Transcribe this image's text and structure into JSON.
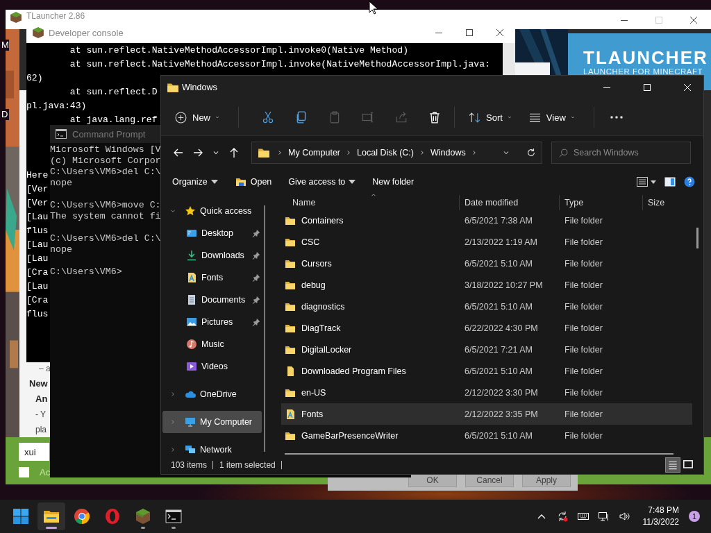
{
  "desktop_labels": [
    "M",
    "D"
  ],
  "tlauncher": {
    "title": "TLauncher 2.86",
    "active": false,
    "banner": {
      "title": "TLAUNCHER",
      "subtitle": "LAUNCHER FOR MINECRAFT"
    },
    "news": [
      {
        "text": "– a",
        "kind": "meta"
      },
      {
        "text": "New",
        "kind": "heading"
      },
      {
        "text": "An",
        "kind": "subheading"
      },
      {
        "text": "- Y",
        "kind": "body"
      },
      {
        "text": "pla",
        "kind": "body"
      }
    ],
    "login_field": {
      "value": "xui"
    },
    "checkbox": {
      "label": "Ac",
      "checked": false
    }
  },
  "dialog": {
    "buttons": [
      "OK",
      "Cancel",
      "Apply"
    ]
  },
  "dev_console": {
    "title": "Developer console",
    "active": false,
    "lines_top": [
      "        at sun.reflect.NativeMethodAccessorImpl.invoke0(Native Method)",
      "        at sun.reflect.NativeMethodAccessorImpl.invoke(NativeMethodAccessorImpl.java:",
      "62)",
      "        at sun.reflect.D",
      "pl.java:43)",
      "        at java.lang.ref"
    ],
    "lines_bottom": [
      "Here",
      "[Ver",
      "[Ver",
      "[Lau",
      "flus",
      "[Lau",
      "[Lau",
      "[Cra",
      "[Lau",
      "[Cra",
      "flus"
    ]
  },
  "command_prompt": {
    "title": "Command Prompt",
    "active": false,
    "blocks": [
      [
        "Microsoft Windows [V",
        "(c) Microsoft Corpor",
        "C:\\Users\\VM6>del C:\\",
        "nope"
      ],
      [
        "C:\\Users\\VM6>move C:",
        "The system cannot fi"
      ],
      [
        "C:\\Users\\VM6>del C:\\",
        "nope"
      ],
      [
        "C:\\Users\\VM6>"
      ]
    ]
  },
  "explorer": {
    "title": "Windows",
    "active": true,
    "command_bar": [
      {
        "kind": "new",
        "label": "New"
      },
      {
        "kind": "separator"
      },
      {
        "kind": "cut",
        "disabled": false
      },
      {
        "kind": "copy",
        "disabled": false
      },
      {
        "kind": "paste",
        "disabled": true
      },
      {
        "kind": "rename",
        "disabled": true
      },
      {
        "kind": "share",
        "disabled": true
      },
      {
        "kind": "delete",
        "disabled": false
      },
      {
        "kind": "separator"
      },
      {
        "kind": "sort",
        "label": "Sort"
      },
      {
        "kind": "view",
        "label": "View"
      },
      {
        "kind": "separator"
      },
      {
        "kind": "more"
      }
    ],
    "address": {
      "segments": [
        "My Computer",
        "Local Disk (C:)",
        "Windows"
      ]
    },
    "search": {
      "placeholder": "Search Windows"
    },
    "toolbar": [
      {
        "kind": "menu",
        "label": "Organize"
      },
      {
        "kind": "open",
        "label": "Open"
      },
      {
        "kind": "menu",
        "label": "Give access to"
      },
      {
        "kind": "plain",
        "label": "New folder"
      }
    ],
    "nav": [
      {
        "label": "Quick access",
        "kind": "star",
        "expanded": true,
        "selected": false,
        "children": [
          {
            "label": "Desktop",
            "kind": "desktop",
            "pinned": true,
            "selected": false
          },
          {
            "label": "Downloads",
            "kind": "downloads",
            "pinned": true,
            "selected": false
          },
          {
            "label": "Fonts",
            "kind": "fonts",
            "pinned": true,
            "selected": false
          },
          {
            "label": "Documents",
            "kind": "documents",
            "pinned": true,
            "selected": false
          },
          {
            "label": "Pictures",
            "kind": "pictures",
            "pinned": true,
            "selected": false
          },
          {
            "label": "Music",
            "kind": "music",
            "pinned": false,
            "selected": false
          },
          {
            "label": "Videos",
            "kind": "videos",
            "pinned": false,
            "selected": false
          }
        ]
      },
      {
        "label": "OneDrive",
        "kind": "cloud",
        "expanded": false,
        "selected": false
      },
      {
        "label": "My Computer",
        "kind": "computer",
        "expanded": false,
        "selected": true
      },
      {
        "label": "Network",
        "kind": "network",
        "expanded": false,
        "selected": false
      }
    ],
    "columns": [
      {
        "label": "Name",
        "sorted": true
      },
      {
        "label": "Date modified",
        "sorted": false
      },
      {
        "label": "Type",
        "sorted": false
      },
      {
        "label": "Size",
        "sorted": false
      }
    ],
    "rows": [
      {
        "name": "Containers",
        "date": "6/5/2021 7:38 AM",
        "type": "File folder",
        "kind": "folder",
        "selected": false
      },
      {
        "name": "CSC",
        "date": "2/13/2022 1:19 AM",
        "type": "File folder",
        "kind": "folder",
        "selected": false
      },
      {
        "name": "Cursors",
        "date": "6/5/2021 5:10 AM",
        "type": "File folder",
        "kind": "folder",
        "selected": false
      },
      {
        "name": "debug",
        "date": "3/18/2022 10:27 PM",
        "type": "File folder",
        "kind": "folder",
        "selected": false
      },
      {
        "name": "diagnostics",
        "date": "6/5/2021 5:10 AM",
        "type": "File folder",
        "kind": "folder",
        "selected": false
      },
      {
        "name": "DiagTrack",
        "date": "6/22/2022 4:30 PM",
        "type": "File folder",
        "kind": "folder",
        "selected": false
      },
      {
        "name": "DigitalLocker",
        "date": "6/5/2021 7:21 AM",
        "type": "File folder",
        "kind": "folder",
        "selected": false
      },
      {
        "name": "Downloaded Program Files",
        "date": "6/5/2021 5:10 AM",
        "type": "File folder",
        "kind": "special",
        "selected": false
      },
      {
        "name": "en-US",
        "date": "2/12/2022 3:30 PM",
        "type": "File folder",
        "kind": "folder",
        "selected": false
      },
      {
        "name": "Fonts",
        "date": "2/12/2022 3:35 PM",
        "type": "File folder",
        "kind": "fonts",
        "selected": true
      },
      {
        "name": "GameBarPresenceWriter",
        "date": "6/5/2021 5:10 AM",
        "type": "File folder",
        "kind": "folder",
        "selected": false
      }
    ],
    "status": {
      "count": "103 items",
      "selection": "1 item selected"
    },
    "view_modes": [
      {
        "kind": "details",
        "selected": true
      },
      {
        "kind": "tiles",
        "selected": false
      }
    ]
  },
  "taskbar": {
    "apps": [
      {
        "kind": "start",
        "running": false,
        "active": false
      },
      {
        "kind": "explorer",
        "running": true,
        "active": true
      },
      {
        "kind": "chrome",
        "running": false,
        "active": false
      },
      {
        "kind": "opera",
        "running": false,
        "active": false
      },
      {
        "kind": "minecraft",
        "running": true,
        "active": false
      },
      {
        "kind": "terminal",
        "running": true,
        "active": false
      }
    ],
    "tray": [
      {
        "kind": "chevron"
      },
      {
        "kind": "sync"
      },
      {
        "kind": "keyboard"
      },
      {
        "kind": "network"
      },
      {
        "kind": "volume"
      }
    ],
    "time": "7:48 PM",
    "date": "11/3/2022",
    "notifications": "1"
  }
}
